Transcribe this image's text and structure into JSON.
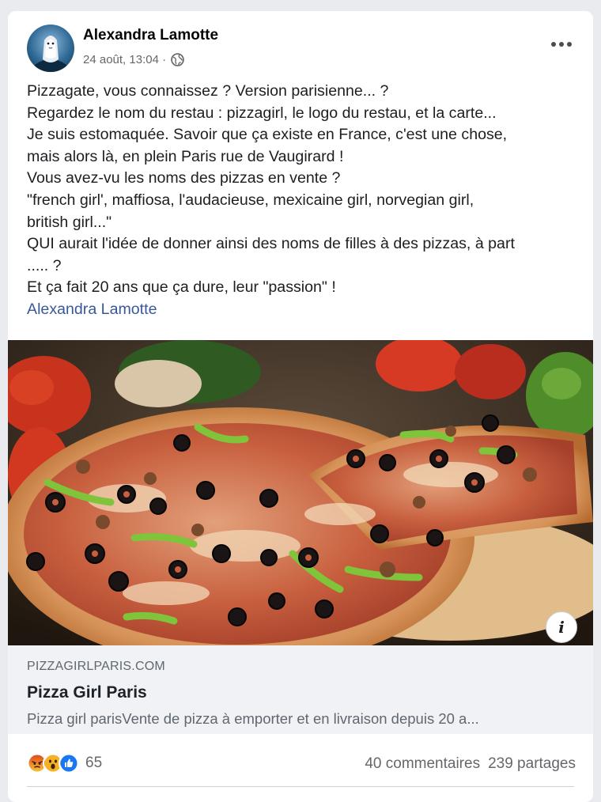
{
  "post": {
    "author": "Alexandra Lamotte",
    "timestamp": "24 août, 13:04 ·",
    "privacy_icon": "globe-icon",
    "text_lines": [
      "Pizzagate, vous connaissez ? Version parisienne... ?",
      " Regardez le nom du restau : pizzagirl, le logo du restau, et la carte...",
      "Je suis estomaquée. Savoir que ça existe en France, c'est une chose,",
      "mais alors là, en plein Paris rue de Vaugirard !",
      "Vous avez-vu les noms des pizzas en vente ?",
      "\"french girl', maffiosa, l'audacieuse, mexicaine girl, norvegian girl,",
      "british girl...\"",
      "QUI aurait l'idée de donner ainsi des noms de filles à des pizzas, à part",
      "..... ?",
      "Et ça fait 20 ans que ça dure, leur \"passion\" !"
    ],
    "author_link": "Alexandra Lamotte"
  },
  "link_preview": {
    "domain": "PIZZAGIRLPARIS.COM",
    "title": "Pizza Girl Paris",
    "description": "Pizza girl parisVente de pizza à emporter et en livraison depuis 20 a...",
    "info_label": "i"
  },
  "stats": {
    "reactions": [
      "angry",
      "wow",
      "like"
    ],
    "reaction_count": "65",
    "comments": "40 commentaires",
    "shares": "239 partages"
  },
  "colors": {
    "link": "#385898",
    "like_blue": "#1877f2",
    "angry_orange": "#e9710f",
    "wow_yellow": "#f7b125"
  }
}
